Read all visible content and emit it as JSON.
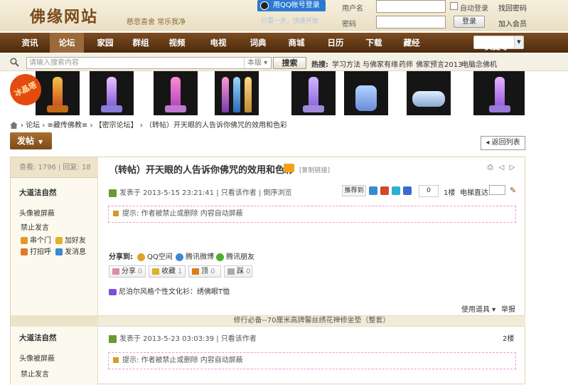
{
  "site": {
    "logo": "佛缘网站",
    "slogan": "慈悲喜舍 常乐我净"
  },
  "login": {
    "qq_button": "用QQ帐号登录",
    "qq_hint": "只需一步，快速开始",
    "username_label": "用户名",
    "password_label": "密码",
    "auto_login": "自动登录",
    "forgot": "找回密码",
    "login_button": "登录",
    "register": "加入会员"
  },
  "nav": {
    "items": [
      "资讯",
      "论坛",
      "家园",
      "群组",
      "视频",
      "电视",
      "词典",
      "商城",
      "日历",
      "下载",
      "藏经"
    ],
    "active": "论坛",
    "quick_nav": "快捷导航"
  },
  "search": {
    "placeholder": "请输入搜索内容",
    "scope": "本版",
    "button": "搜索",
    "hot_label": "热搜:",
    "hot": [
      "学习方法",
      "与佛家有缘",
      "药师",
      "佛家预言2013",
      "电脑念佛机"
    ]
  },
  "banner": {
    "stamp": "冰晶塔"
  },
  "breadcrumb": [
    "论坛",
    "≡藏传佛教≡",
    "【密宗论坛】",
    "（转帖）开天眼的人告诉你佛咒的效用和色彩"
  ],
  "post_button": "发帖",
  "back_button": "返回列表",
  "thread": {
    "views_label": "查看:",
    "views": "1796",
    "replies_label": "回复:",
    "replies": "18",
    "title": "（转帖）开天眼的人告诉你佛咒的效用和色彩",
    "copy_link": "[复制链接]"
  },
  "posts": [
    {
      "author": "大道法自然",
      "avatar_note": "头像被屏蔽",
      "banned": "禁止发言",
      "links": [
        "串个门",
        "加好友",
        "打招呼",
        "发消息"
      ],
      "time": "发表于 2013-5-15 23:21:41",
      "only_author": "只看该作者",
      "reverse": "倒序浏览",
      "recommend": "推荐到",
      "rec_count": "0",
      "floor": "1楼",
      "direct": "电梯直达",
      "notice": "提示: 作者被禁止或删除 内容自动屏蔽",
      "share_label": "分享到:",
      "share": [
        "QQ空间",
        "腾讯微博",
        "腾讯朋友"
      ],
      "actions": [
        {
          "label": "分享",
          "count": "0"
        },
        {
          "label": "收藏",
          "count": "1"
        },
        {
          "label": "顶",
          "count": "0"
        },
        {
          "label": "踩",
          "count": "0"
        }
      ],
      "ad": "尼泊尔风格个性文化衫：绣佛眼T恤",
      "tools": "使用道具",
      "report": "举报"
    },
    {
      "author": "大道法自然",
      "avatar_note": "头像被屏蔽",
      "banned": "禁止发言",
      "time": "发表于 2013-5-23 03:03:39",
      "only_author": "只看该作者",
      "floor": "2楼",
      "notice": "提示: 作者被禁止或删除 内容自动屏蔽"
    }
  ],
  "separator_ad": "修行必备--70厘米高牌馨丝绣花禅修坐垫（整套）",
  "colors": {
    "nav_bg": "#5e3714",
    "accent": "#8a5a24",
    "notice_border": "#ee9cc0",
    "link_blue": "#2a7ad2"
  }
}
